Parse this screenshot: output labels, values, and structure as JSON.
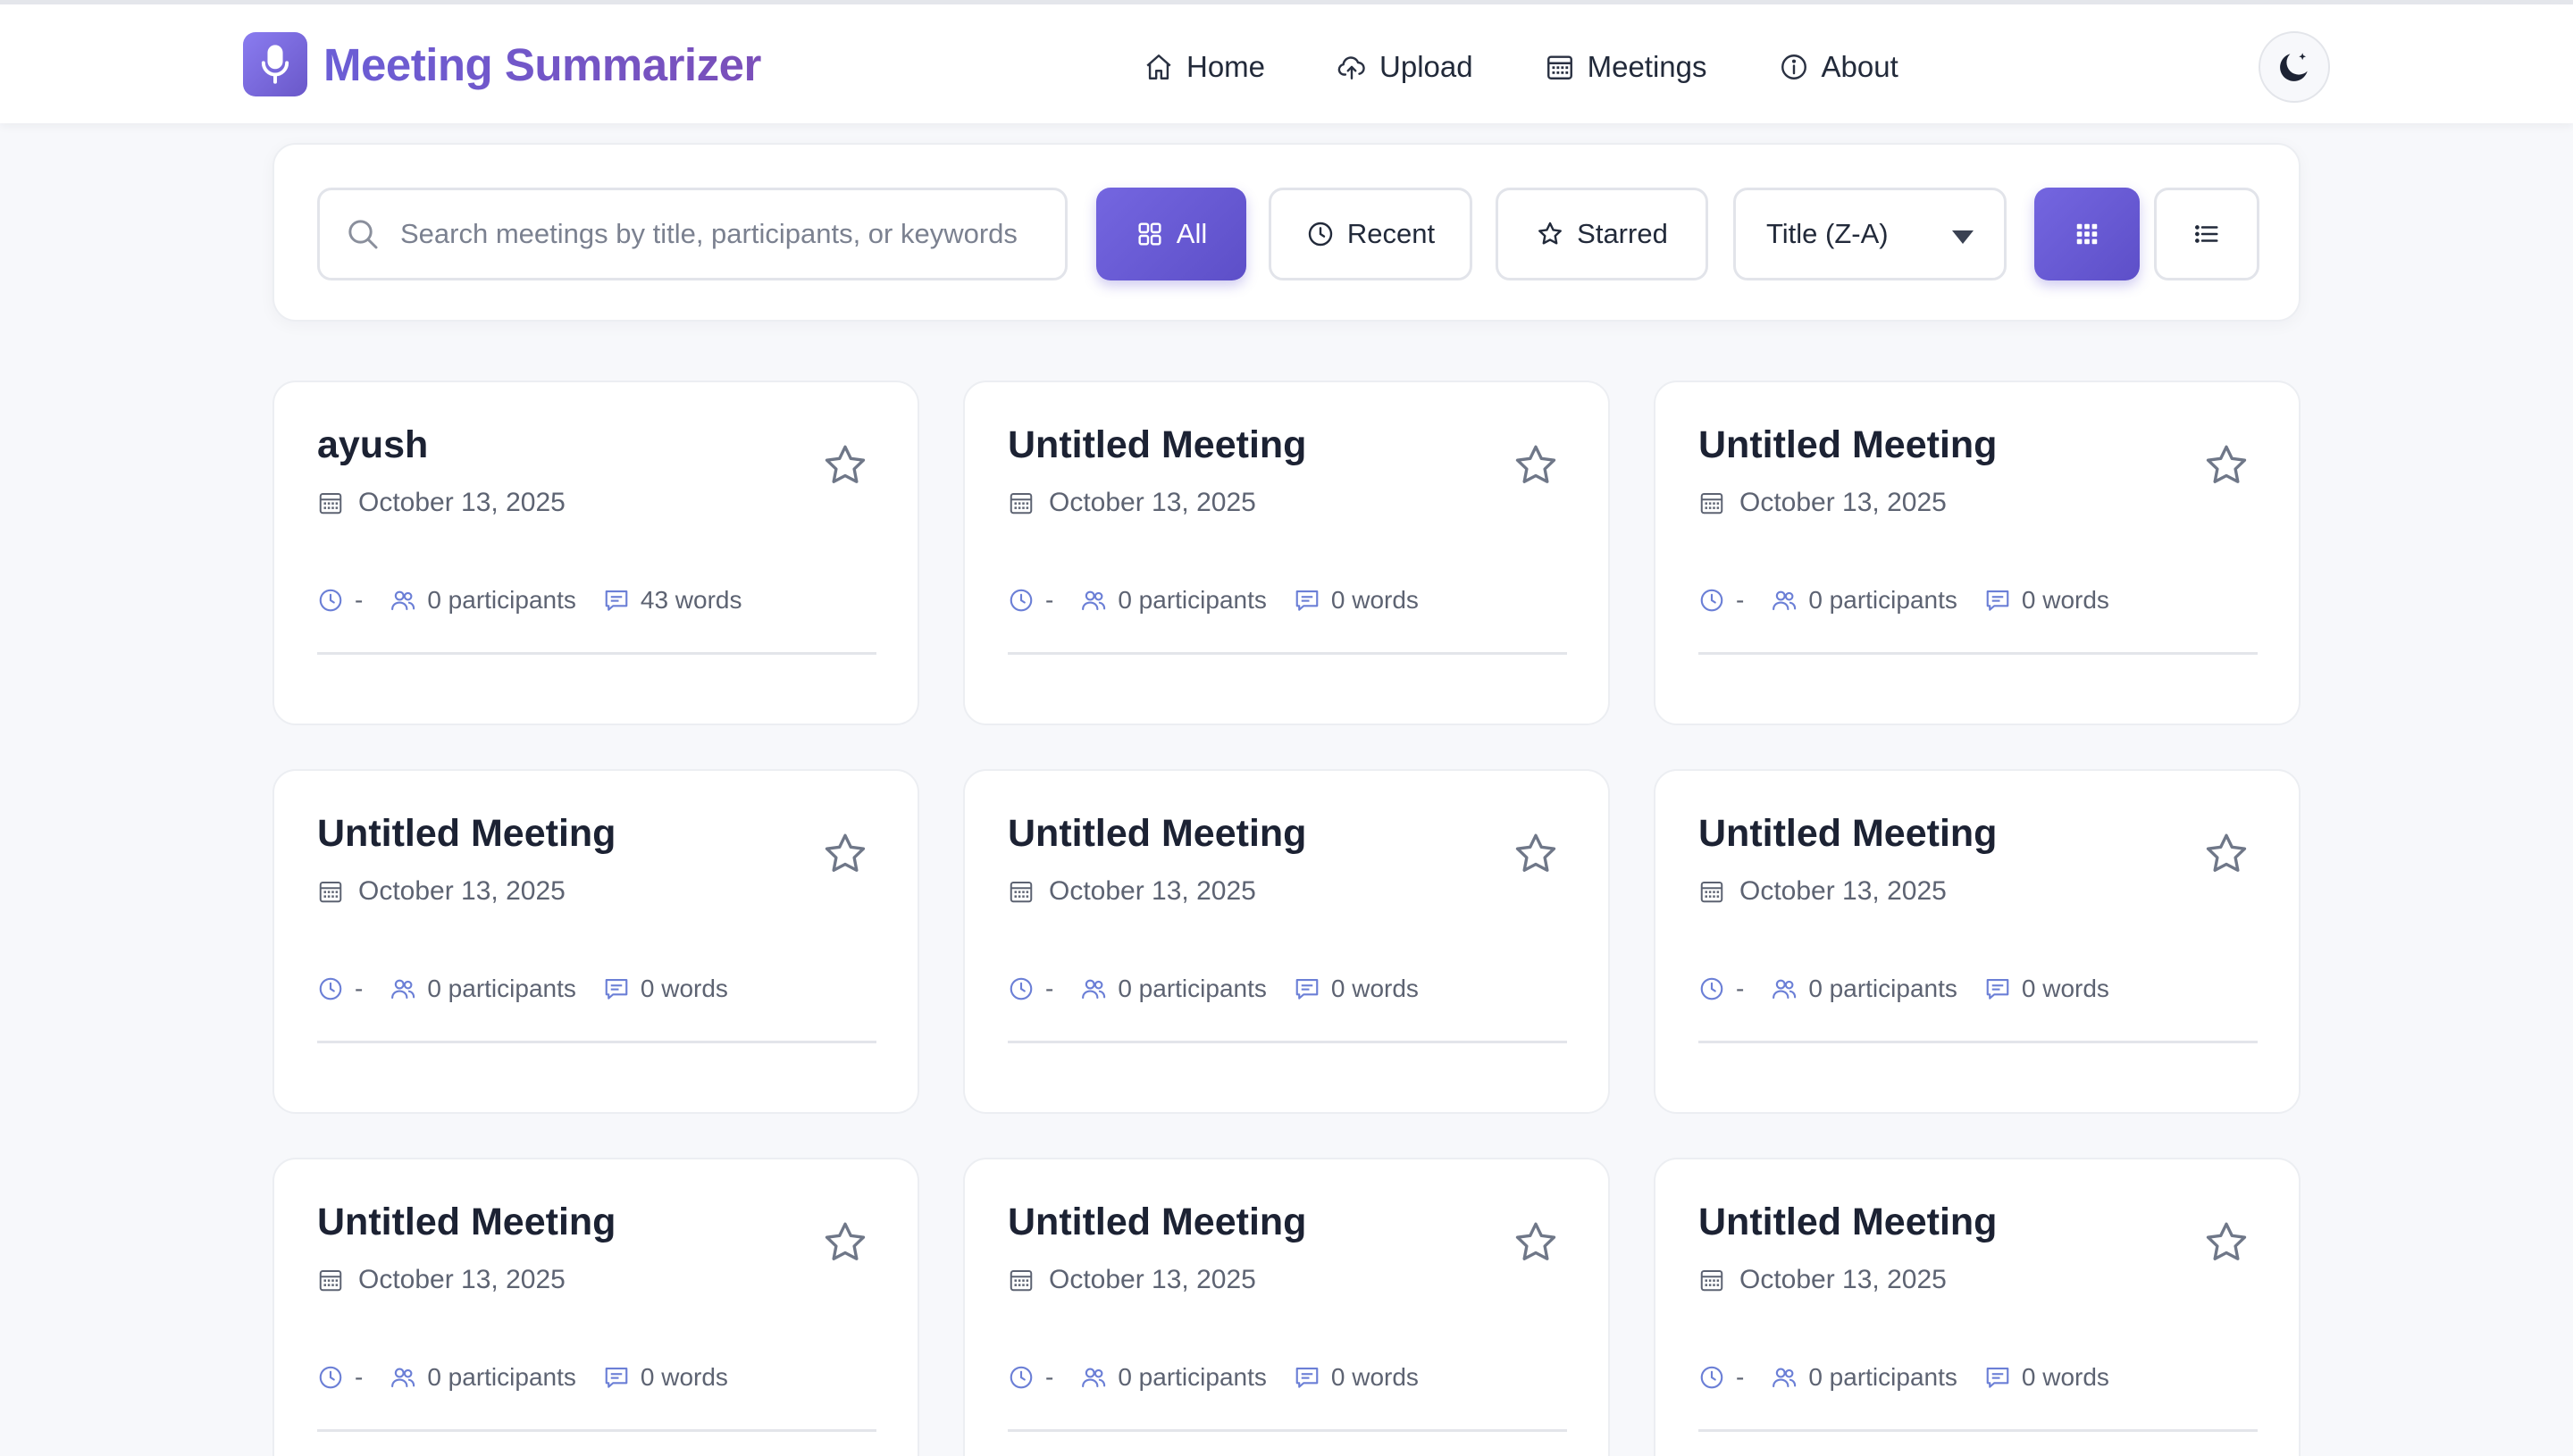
{
  "app": {
    "title": "Meeting Summarizer"
  },
  "nav": [
    {
      "label": "Home",
      "icon": "home-icon"
    },
    {
      "label": "Upload",
      "icon": "cloud-upload-icon"
    },
    {
      "label": "Meetings",
      "icon": "calendar-icon"
    },
    {
      "label": "About",
      "icon": "info-icon"
    }
  ],
  "theme_toggle": {
    "icon": "moon-icon"
  },
  "search": {
    "placeholder": "Search meetings by title, participants, or keywords",
    "value": ""
  },
  "filters": {
    "all": "All",
    "recent": "Recent",
    "starred": "Starred",
    "active": "all"
  },
  "sort": {
    "selected": "Title (Z-A)"
  },
  "view": {
    "active": "grid"
  },
  "colors": {
    "accent": "#6a5bd0",
    "accent_dark": "#5d4fc8",
    "icon_accent": "#6b7fd6"
  },
  "meetings": [
    {
      "title": "ayush",
      "date": "October 13, 2025",
      "duration": "-",
      "participants": "0 participants",
      "words": "43 words",
      "starred": false
    },
    {
      "title": "Untitled Meeting",
      "date": "October 13, 2025",
      "duration": "-",
      "participants": "0 participants",
      "words": "0 words",
      "starred": false
    },
    {
      "title": "Untitled Meeting",
      "date": "October 13, 2025",
      "duration": "-",
      "participants": "0 participants",
      "words": "0 words",
      "starred": false
    },
    {
      "title": "Untitled Meeting",
      "date": "October 13, 2025",
      "duration": "-",
      "participants": "0 participants",
      "words": "0 words",
      "starred": false
    },
    {
      "title": "Untitled Meeting",
      "date": "October 13, 2025",
      "duration": "-",
      "participants": "0 participants",
      "words": "0 words",
      "starred": false
    },
    {
      "title": "Untitled Meeting",
      "date": "October 13, 2025",
      "duration": "-",
      "participants": "0 participants",
      "words": "0 words",
      "starred": false
    },
    {
      "title": "Untitled Meeting",
      "date": "October 13, 2025",
      "duration": "-",
      "participants": "0 participants",
      "words": "0 words",
      "starred": false
    },
    {
      "title": "Untitled Meeting",
      "date": "October 13, 2025",
      "duration": "-",
      "participants": "0 participants",
      "words": "0 words",
      "starred": false
    },
    {
      "title": "Untitled Meeting",
      "date": "October 13, 2025",
      "duration": "-",
      "participants": "0 participants",
      "words": "0 words",
      "starred": false
    }
  ]
}
